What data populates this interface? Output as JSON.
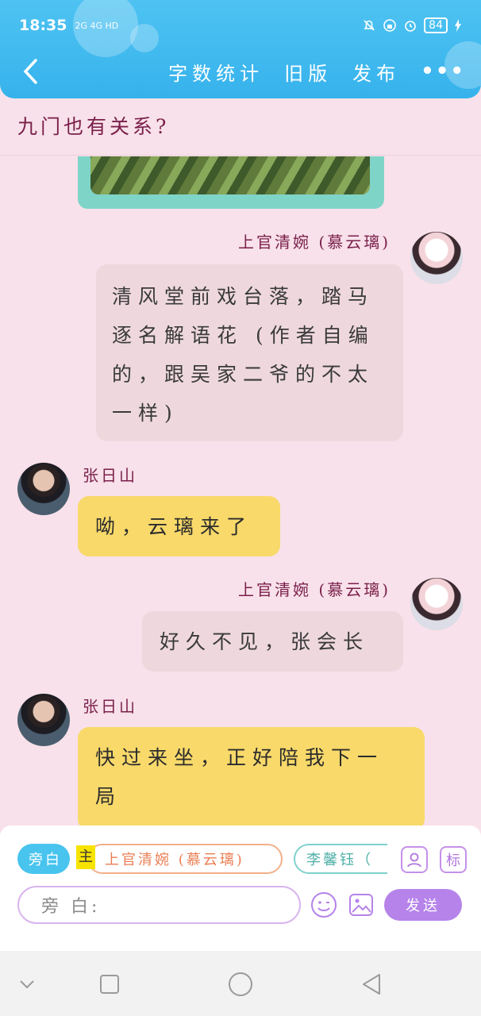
{
  "status": {
    "time": "18:35",
    "network": "2G 4G HD",
    "battery": "84"
  },
  "nav": {
    "word_count": "字数统计",
    "old_version": "旧版",
    "publish": "发布",
    "more": "•••"
  },
  "title": "九门也有关系?",
  "messages": [
    {
      "sender": "上官清婉 (慕云璃)",
      "side": "right",
      "text": "清风堂前戏台落，踏马逐名解语花 (作者自编的，跟吴家二爷的不太一样)"
    },
    {
      "sender": "张日山",
      "side": "left",
      "text": "呦，云璃来了"
    },
    {
      "sender": "上官清婉 (慕云璃)",
      "side": "right",
      "text": "好久不见，张会长"
    },
    {
      "sender": "张日山",
      "side": "left",
      "text": "快过来坐，正好陪我下一局"
    }
  ],
  "bottom": {
    "roles": [
      {
        "label": "旁白"
      },
      {
        "label": "上官清婉 (慕云璃)"
      },
      {
        "label": "李馨钰（"
      }
    ],
    "main_tag": "主",
    "mark_label": "标",
    "input_placeholder": "旁 白:",
    "send_label": "发送"
  },
  "colors": {
    "header": "#36b2ec",
    "background": "#f8e1ea",
    "name": "#7a1f4a",
    "yellow_bubble": "#f8d96a",
    "gray_bubble": "#eed8de",
    "send": "#b583ea"
  }
}
